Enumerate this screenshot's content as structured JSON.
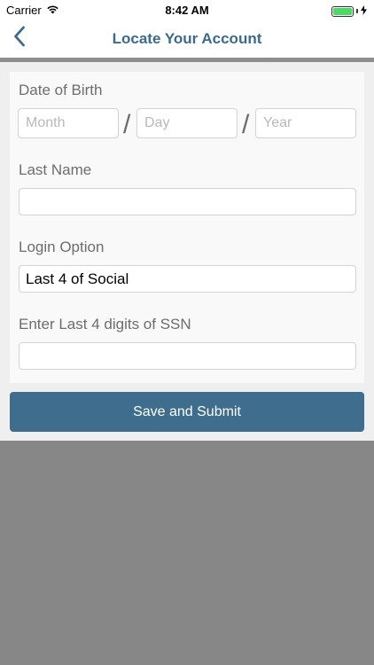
{
  "status_bar": {
    "carrier": "Carrier",
    "time": "8:42 AM",
    "battery_level": 1.0
  },
  "nav": {
    "title": "Locate Your Account",
    "back_icon": "chevron-left-icon",
    "accent_color": "#3a6a8c"
  },
  "form": {
    "dob_label": "Date of Birth",
    "month_placeholder": "Month",
    "day_placeholder": "Day",
    "year_placeholder": "Year",
    "separator": "/",
    "last_name_label": "Last Name",
    "last_name_value": "",
    "login_option_label": "Login Option",
    "login_option_value": "Last 4 of Social",
    "ssn_label": "Enter Last 4 digits of SSN",
    "ssn_value": ""
  },
  "submit": {
    "label": "Save and Submit",
    "color": "#3e6d8e"
  }
}
